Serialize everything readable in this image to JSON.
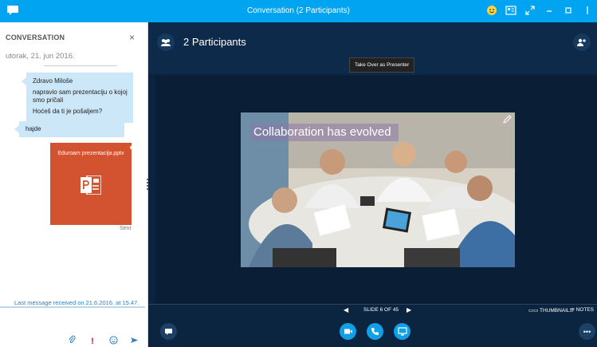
{
  "window": {
    "title": "Conversation (2 Participants)"
  },
  "conversation": {
    "heading": "CONVERSATION",
    "close_label": "×",
    "date": "utorak, 21. jun 2016.",
    "incoming_lines": [
      "Zdravo Miloše",
      "napravio sam prezentaciju o kojoj smo pričali",
      "Hoćeš da ti je pošaljem?"
    ],
    "outgoing": "hajde",
    "file_name": "Eduroam prezentacija.pptx",
    "sent_label": "Sent",
    "last_message": "Last message received on 21.6.2016. at 15.47."
  },
  "stage": {
    "participants_label": "2 Participants",
    "tooltip": "Take Over as Presenter",
    "slide_title": "Collaboration has evolved",
    "slide_nav": "SLIDE 6 OF 45",
    "slide_current": 6,
    "slide_total": 45,
    "thumbnails_label": "THUMBNAILS",
    "notes_label": "NOTES"
  },
  "colors": {
    "titlebar": "#00a4f0",
    "stage_bg": "#0b2440",
    "accent_blue": "#11a0e6",
    "ppt_orange": "#d35230",
    "bubble": "#cce7f8"
  }
}
